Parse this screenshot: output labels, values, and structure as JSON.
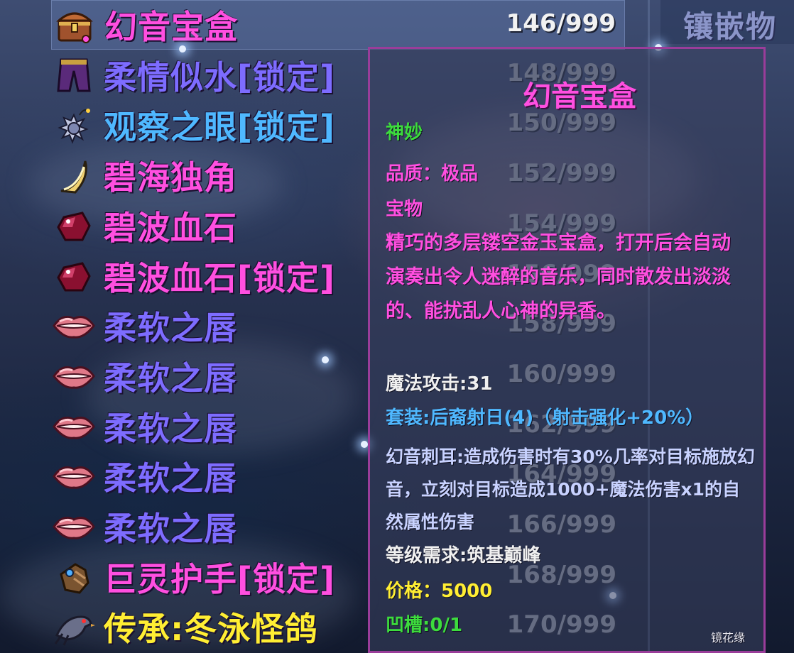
{
  "header": {
    "category_label": "镶嵌物"
  },
  "inventory": {
    "items": [
      {
        "name": "幻音宝盒",
        "count": "146/999",
        "color": "#ff4fe0",
        "icon": "treasure-chest-icon",
        "selected": true
      },
      {
        "name": "柔情似水[锁定]",
        "count": "148/999",
        "color": "#7d6cff",
        "icon": "purple-pants-icon"
      },
      {
        "name": "观察之眼[锁定]",
        "count": "150/999",
        "color": "#4fb8ff",
        "icon": "spiked-bomb-icon"
      },
      {
        "name": "碧海独角",
        "count": "152/999",
        "color": "#ff4fe0",
        "icon": "horn-icon"
      },
      {
        "name": "碧波血石",
        "count": "154/999",
        "color": "#ff4fe0",
        "icon": "blood-gem-icon"
      },
      {
        "name": "碧波血石[锁定]",
        "count": "156/999",
        "color": "#ff4fe0",
        "icon": "blood-gem-icon"
      },
      {
        "name": "柔软之唇",
        "count": "158/999",
        "color": "#7d6cff",
        "icon": "lips-icon"
      },
      {
        "name": "柔软之唇",
        "count": "160/999",
        "color": "#7d6cff",
        "icon": "lips-icon"
      },
      {
        "name": "柔软之唇",
        "count": "162/999",
        "color": "#7d6cff",
        "icon": "lips-icon"
      },
      {
        "name": "柔软之唇",
        "count": "164/999",
        "color": "#7d6cff",
        "icon": "lips-icon"
      },
      {
        "name": "柔软之唇",
        "count": "166/999",
        "color": "#7d6cff",
        "icon": "lips-icon"
      },
      {
        "name": "巨灵护手[锁定]",
        "count": "168/999",
        "color": "#ff4fe0",
        "icon": "gauntlet-icon"
      },
      {
        "name": "传承:冬泳怪鸽",
        "count": "170/999",
        "color": "#ffee33",
        "icon": "pigeon-icon"
      }
    ]
  },
  "tooltip": {
    "title": "幻音宝盒",
    "rarity": "神妙",
    "quality": "品质：极品",
    "type": "宝物",
    "description": "精巧的多层镂空金玉宝盒，打开后会自动演奏出令人迷醉的音乐，同时散发出淡淡的、能扰乱人心神的异香。",
    "magic_attack": "魔法攻击:31",
    "set_bonus": "套装:后裔射日(4)（射击强化+20%）",
    "skill": "幻音刺耳:造成伤害时有30%几率对目标施放幻音，立刻对目标造成1000+魔法伤害x1的自然属性伤害",
    "level_req": "等级需求:筑基巅峰",
    "price": "价格：5000",
    "slots": "凹槽:0/1",
    "maker": "镜花缘"
  },
  "colors": {
    "rarity": "#3ddc3d",
    "quality": "#ff4fe0",
    "magic_attack": "#f0f0f0",
    "set_bonus": "#4fb8ff",
    "level_req": "#f0f0f0",
    "price": "#ffee33",
    "slots": "#3ddc3d"
  }
}
